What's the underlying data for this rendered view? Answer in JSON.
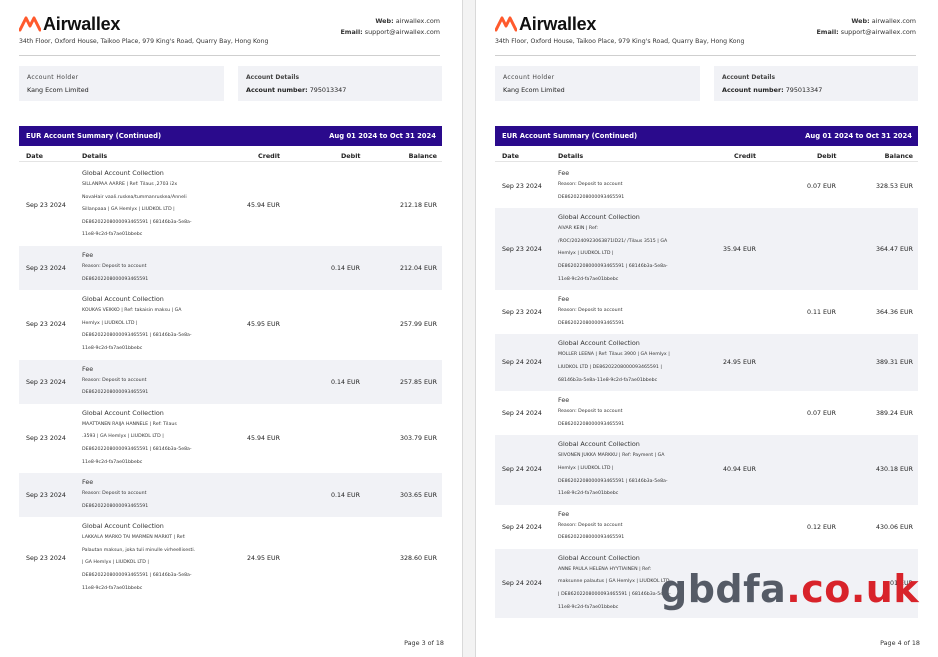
{
  "brand": {
    "name": "Airwallex",
    "logo_color": "#ff5a2d",
    "address": "34th Floor, Oxford House, Taikoo Place, 979 King's Road, Quarry Bay, Hong Kong",
    "web_label": "Web:",
    "web": "airwallex.com",
    "email_label": "Email:",
    "email": "support@airwallex.com"
  },
  "account": {
    "holder_label": "Account Holder",
    "holder": "Kang Ecom Limited",
    "details_label": "Account Details",
    "number_label": "Account number:",
    "number": "795013347"
  },
  "summary": {
    "title": "EUR Account Summary (Continued)",
    "period": "Aug 01 2024 to Oct 31 2024",
    "bar_color": "#2a0a8c"
  },
  "columns": {
    "date": "Date",
    "details": "Details",
    "credit": "Credit",
    "debit": "Debit",
    "balance": "Balance"
  },
  "pages": [
    {
      "page_label": "Page 3 of 18",
      "rows": [
        {
          "date": "Sep 23 2024",
          "title": "Global Account Collection",
          "lines": [
            "SILLANPAA AARRE | Ref: Tilaus ,2703 i2x",
            "NovaHair vaali.ruskea/tummanruskea/Anneli",
            "Sillanpaaa | GA Hemlyx | LIUDKOL LTD |",
            "DE86202208000093465591 | 68146b3a-5e8a-",
            "11e8-9c2d-fa7ae01bbebc"
          ],
          "credit": "45.94 EUR",
          "debit": "",
          "balance": "212.18 EUR"
        },
        {
          "date": "Sep 23 2024",
          "title": "Fee",
          "lines": [
            "Reason: Deposit to account",
            "DE86202208000093465591"
          ],
          "credit": "",
          "debit": "0.14 EUR",
          "balance": "212.04 EUR"
        },
        {
          "date": "Sep 23 2024",
          "title": "Global Account Collection",
          "lines": [
            "KOUKAS VEIKKO | Ref: takaisin maksu | GA",
            "Hemlyx | LIUDKOL LTD |",
            "DE86202208000093465591 | 68146b3a-5e8a-",
            "11e8-9c2d-fa7ae01bbebc"
          ],
          "credit": "45.95 EUR",
          "debit": "",
          "balance": "257.99 EUR"
        },
        {
          "date": "Sep 23 2024",
          "title": "Fee",
          "lines": [
            "Reason: Deposit to account",
            "DE86202208000093465591"
          ],
          "credit": "",
          "debit": "0.14 EUR",
          "balance": "257.85 EUR"
        },
        {
          "date": "Sep 23 2024",
          "title": "Global Account Collection",
          "lines": [
            "MAATTANEN RAIJA HANNELE | Ref: Tilaus",
            ".3593 | GA Hemlyx | LIUDKOL LTD |",
            "DE86202208000093465591 | 68146b3a-5e8a-",
            "11e8-9c2d-fa7ae01bbebc"
          ],
          "credit": "45.94 EUR",
          "debit": "",
          "balance": "303.79 EUR"
        },
        {
          "date": "Sep 23 2024",
          "title": "Fee",
          "lines": [
            "Reason: Deposit to account",
            "DE86202208000093465591"
          ],
          "credit": "",
          "debit": "0.14 EUR",
          "balance": "303.65 EUR"
        },
        {
          "date": "Sep 23 2024",
          "title": "Global Account Collection",
          "lines": [
            "LAKKALA MARKO TAI MARMEN MARKIT | Ref:",
            "Palautan maksun, joka tuli minulle virheellisesti.",
            "| GA Hemlyx | LIUDKOL LTD |",
            "DE86202208000093465591 | 68146b3a-5e8a-",
            "11e8-9c2d-fa7ae01bbebc"
          ],
          "credit": "24.95 EUR",
          "debit": "",
          "balance": "328.60 EUR"
        }
      ]
    },
    {
      "page_label": "Page 4 of 18",
      "rows": [
        {
          "date": "Sep 23 2024",
          "title": "Fee",
          "lines": [
            "Reason: Deposit to account",
            "DE86202208000093465591"
          ],
          "credit": "",
          "debit": "0.07 EUR",
          "balance": "328.53 EUR"
        },
        {
          "date": "Sep 23 2024",
          "title": "Global Account Collection",
          "lines": [
            "AIVAR KEIN | Ref:",
            "/ROC/20240923063871ID21/ /Tilaus 3515 | GA",
            "Hemlyx | LIUDKOL LTD |",
            "DE86202208000093465591 | 68146b3a-5e8a-",
            "11e8-9c2d-fa7ae01bbebc"
          ],
          "credit": "35.94 EUR",
          "debit": "",
          "balance": "364.47 EUR"
        },
        {
          "date": "Sep 23 2024",
          "title": "Fee",
          "lines": [
            "Reason: Deposit to account",
            "DE86202208000093465591"
          ],
          "credit": "",
          "debit": "0.11 EUR",
          "balance": "364.36 EUR"
        },
        {
          "date": "Sep 24 2024",
          "title": "Global Account Collection",
          "lines": [
            "MOLLER LEENA | Ref: Tilaus 3900 | GA Hemlyx |",
            "LIUDKOL LTD | DE86202208000093465591 |",
            "68146b3a-5e8a-11e8-9c2d-fa7ae01bbebc"
          ],
          "credit": "24.95 EUR",
          "debit": "",
          "balance": "389.31 EUR"
        },
        {
          "date": "Sep 24 2024",
          "title": "Fee",
          "lines": [
            "Reason: Deposit to account",
            "DE86202208000093465591"
          ],
          "credit": "",
          "debit": "0.07 EUR",
          "balance": "389.24 EUR"
        },
        {
          "date": "Sep 24 2024",
          "title": "Global Account Collection",
          "lines": [
            "SIIVONEN JUKKA MARKKU | Ref: Payment | GA",
            "Hemlyx | LIUDKOL LTD |",
            "DE86202208000093465591 | 68146b3a-5e8a-",
            "11e8-9c2d-fa7ae01bbebc"
          ],
          "credit": "40.94 EUR",
          "debit": "",
          "balance": "430.18 EUR"
        },
        {
          "date": "Sep 24 2024",
          "title": "Fee",
          "lines": [
            "Reason: Deposit to account",
            "DE86202208000093465591"
          ],
          "credit": "",
          "debit": "0.12 EUR",
          "balance": "430.06 EUR"
        },
        {
          "date": "Sep 24 2024",
          "title": "Global Account Collection",
          "lines": [
            "ANNE PAULA HELENA HYYTIAINEN | Ref:",
            "maksunne palautus | GA Hemlyx | LIUDKOL LTD",
            "| DE86202208000093465591 | 68146b3a-5e8a-",
            "11e8-9c2d-fa7ae01bbebc"
          ],
          "credit": "",
          "debit": "",
          "balance": ".01 EUR"
        }
      ]
    }
  ],
  "watermark": {
    "part1": "gbdfa",
    "part2": ".co.uk"
  }
}
